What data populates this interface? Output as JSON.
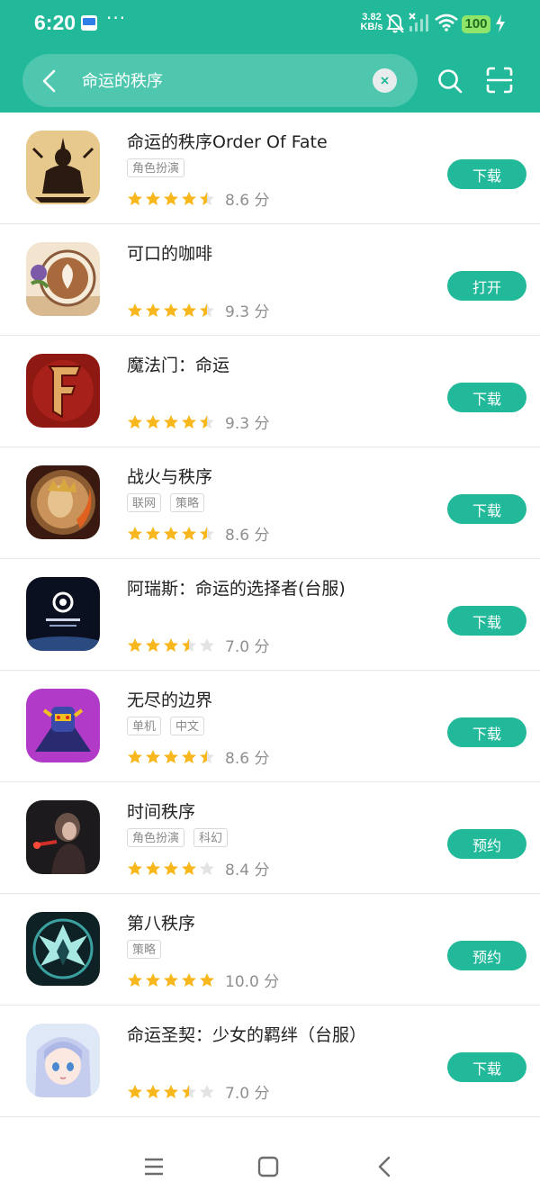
{
  "status_bar": {
    "time": "6:20",
    "more": "···",
    "net_speed_value": "3.82",
    "net_speed_unit": "KB/s",
    "battery": "100"
  },
  "search": {
    "query": "命运的秩序"
  },
  "results": [
    {
      "name": "命运的秩序Order Of Fate",
      "tags": [
        "角色扮演"
      ],
      "rating": 4.5,
      "score": "8.6 分",
      "action": "下载",
      "icon": "order-of-fate-icon"
    },
    {
      "name": "可口的咖啡",
      "tags": [],
      "rating": 4.5,
      "score": "9.3 分",
      "action": "打开",
      "icon": "coffee-icon"
    },
    {
      "name": "魔法门：命运",
      "tags": [],
      "rating": 4.5,
      "score": "9.3 分",
      "action": "下载",
      "icon": "might-magic-fate-icon"
    },
    {
      "name": "战火与秩序",
      "tags": [
        "联网",
        "策略"
      ],
      "rating": 4.5,
      "score": "8.6 分",
      "action": "下载",
      "icon": "march-of-empires-icon"
    },
    {
      "name": "阿瑞斯：命运的选择者(台服)",
      "tags": [],
      "rating": 3.5,
      "score": "7.0 分",
      "action": "下载",
      "icon": "ares-icon"
    },
    {
      "name": "无尽的边界",
      "tags": [
        "单机",
        "中文"
      ],
      "rating": 4.5,
      "score": "8.6 分",
      "action": "下载",
      "icon": "robot-warrior-icon"
    },
    {
      "name": "时间秩序",
      "tags": [
        "角色扮演",
        "科幻"
      ],
      "rating": 4.0,
      "score": "8.4 分",
      "action": "预约",
      "icon": "time-order-icon"
    },
    {
      "name": "第八秩序",
      "tags": [
        "策略"
      ],
      "rating": 5.0,
      "score": "10.0 分",
      "action": "预约",
      "icon": "eighth-order-icon"
    },
    {
      "name": "命运圣契：少女的羁绊（台服）",
      "tags": [],
      "rating": 3.5,
      "score": "7.0 分",
      "action": "下载",
      "icon": "anime-girl-icon"
    }
  ],
  "colors": {
    "accent": "#22b99a",
    "star": "#f7b71d",
    "star_empty": "#e3e3e3"
  }
}
